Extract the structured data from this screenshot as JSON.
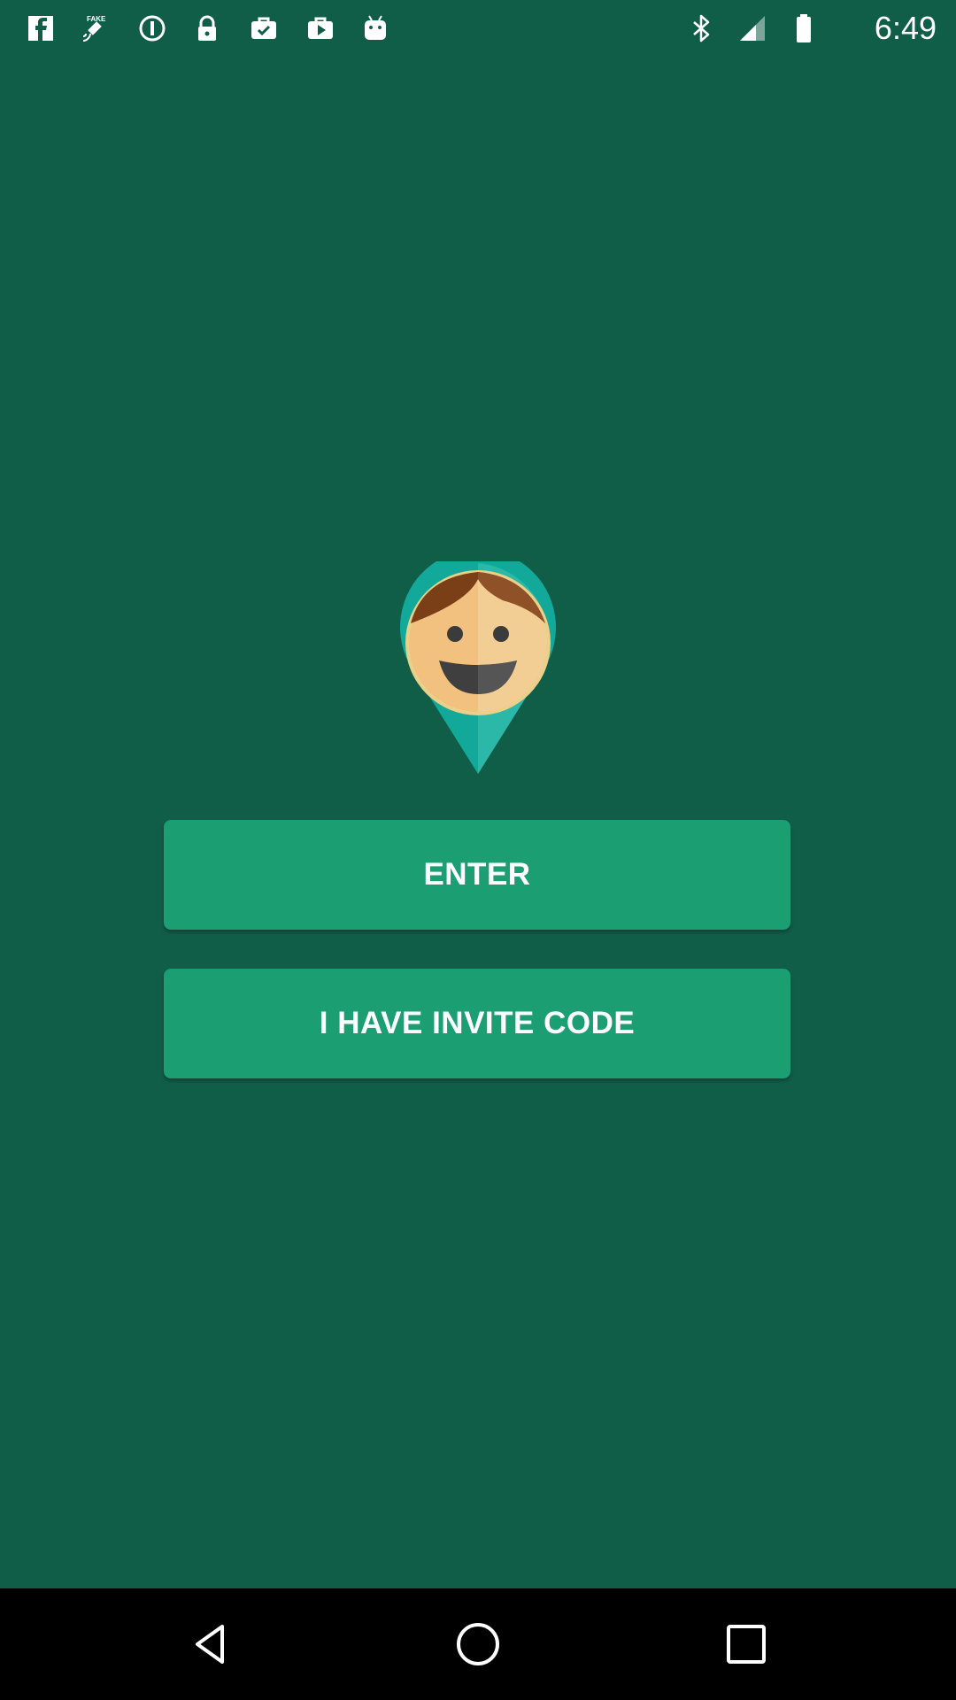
{
  "status_bar": {
    "time": "6:49",
    "left_icons": [
      "facebook-icon",
      "fake-gps-icon",
      "info-icon",
      "lock-icon",
      "briefcase-check-icon",
      "play-briefcase-icon",
      "android-icon"
    ],
    "right_icons": [
      "bluetooth-icon",
      "signal-icon",
      "battery-icon"
    ]
  },
  "logo": {
    "icon": "child-location-pin-icon"
  },
  "buttons": {
    "enter_label": "ENTER",
    "invite_label": "I HAVE INVITE CODE"
  },
  "nav_bar": {
    "icons": [
      "back-icon",
      "home-icon",
      "recents-icon"
    ]
  },
  "colors": {
    "background": "#115e48",
    "button": "#1a9e72",
    "pin": "#14a99a",
    "nav_bar": "#000000"
  }
}
